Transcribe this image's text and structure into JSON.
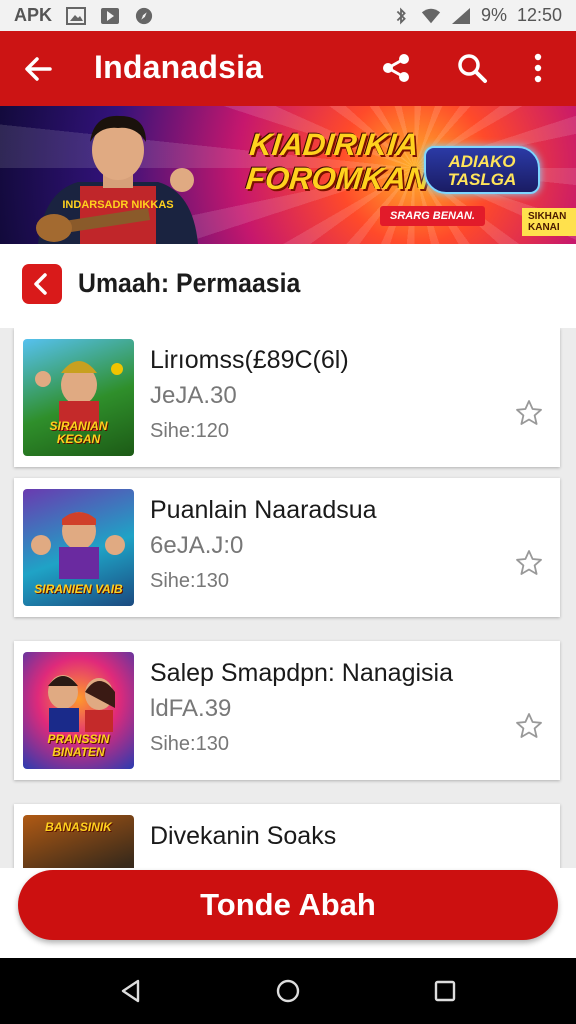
{
  "status_bar": {
    "left_text": "APK",
    "right_text": "9%",
    "time": "12:50"
  },
  "app_bar": {
    "title": "Indanadsia"
  },
  "banner": {
    "character_shirt_text": "INDARSADR NIKKAS",
    "headline": "KIADIRIKIA FOROMKAN",
    "logo_text": "ADIAKO TASLGA",
    "pill_text": "SRARG BENAN.",
    "corner_tag": "SIKHAN KANAI"
  },
  "section": {
    "title": "Umaah: Permaasia"
  },
  "items": [
    {
      "name": "Lirıomss(£89C(6l)",
      "price": "JeJA.30",
      "size": "Sihe:120",
      "thumb_caption": "SIRANIAN KEGAN",
      "thumb_colors": [
        "#2f8f2b",
        "#f0b400"
      ]
    },
    {
      "name": "Puanlain Naaradsua",
      "price": "6eJA.J:0",
      "size": "Sihe:130",
      "thumb_caption": "SIRANIEN VAIB",
      "thumb_colors": [
        "#3a2a8f",
        "#1fa3c6"
      ]
    },
    {
      "name": "Salep Smapdpn: Nanagisia",
      "price": "ldFA.39",
      "size": "Sihe:130",
      "thumb_caption": "PRANSSIN BINATEN",
      "thumb_colors": [
        "#e02a7a",
        "#2a3bb0"
      ]
    },
    {
      "name": "Divekanin Soaks",
      "price": "",
      "size": "",
      "thumb_caption": "BANASINIK",
      "thumb_colors": [
        "#1a1a3a",
        "#b05a14"
      ]
    }
  ],
  "cta": {
    "label": "Tonde Abah"
  },
  "colors": {
    "brand": "#cc1414",
    "background": "#ececec"
  }
}
